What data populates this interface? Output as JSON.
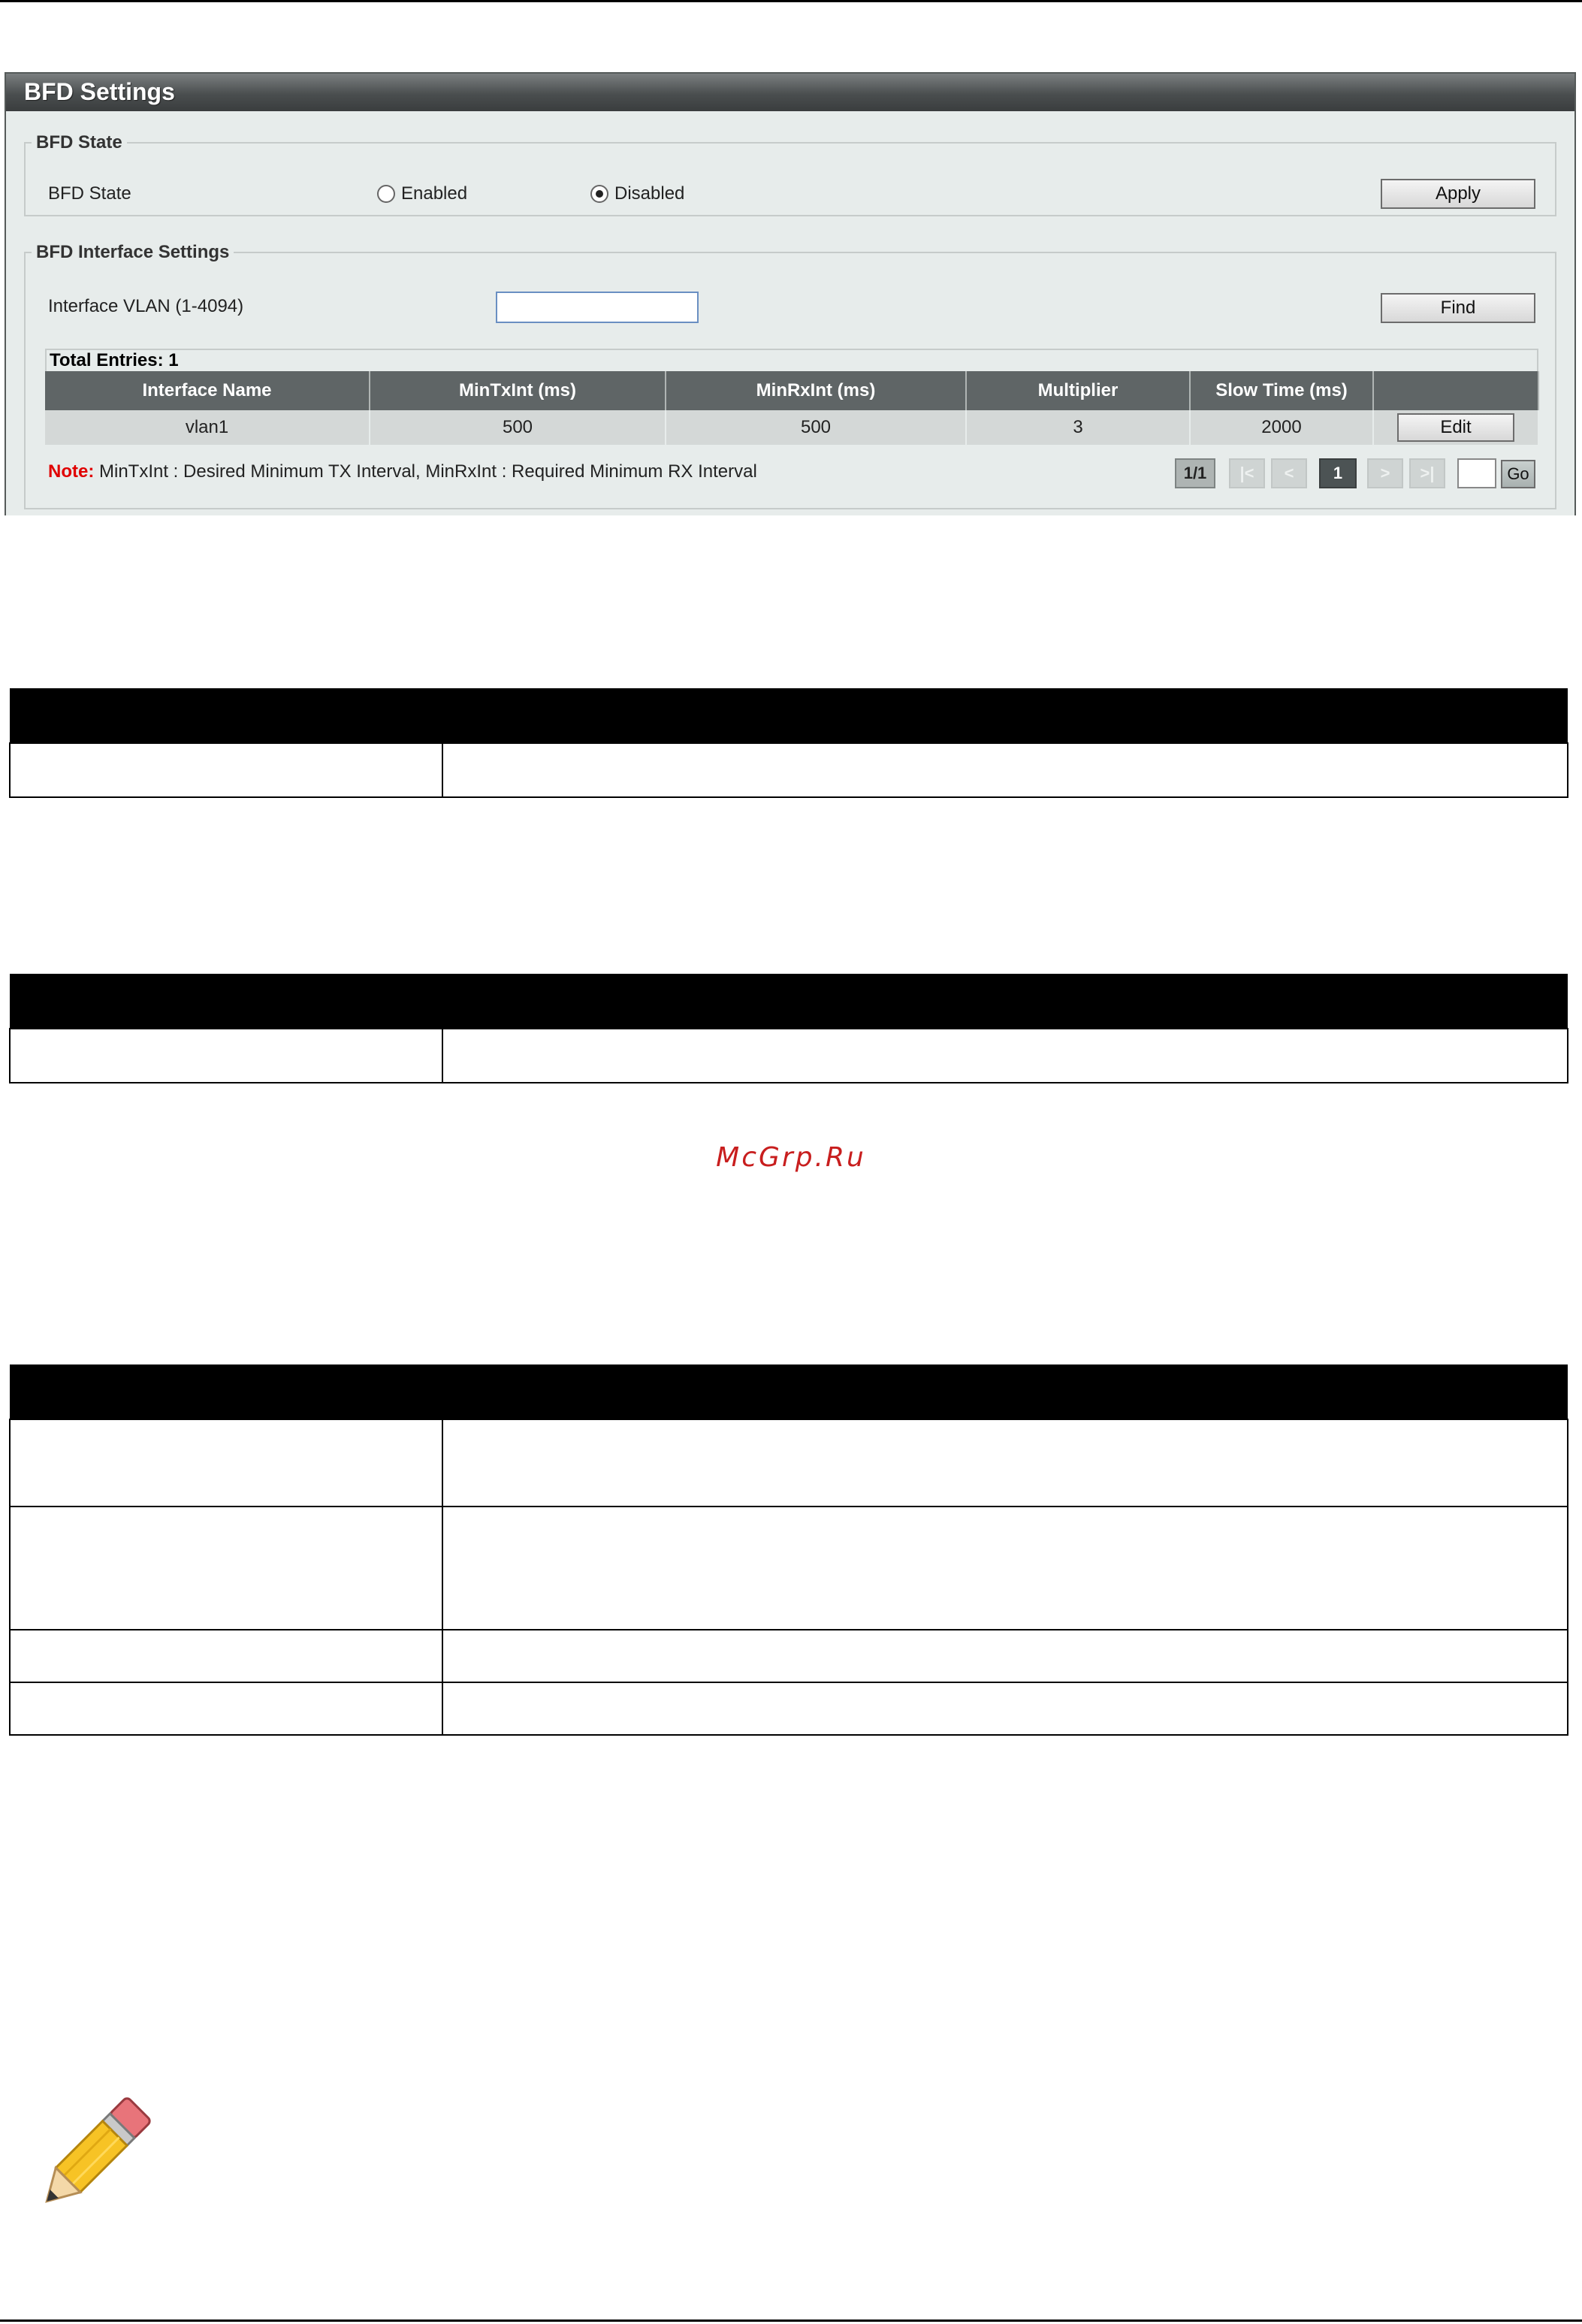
{
  "window": {
    "title": "BFD Settings"
  },
  "bfd_state_section": {
    "legend": "BFD State",
    "label": "BFD State",
    "options": [
      {
        "label": "Enabled",
        "selected": false
      },
      {
        "label": "Disabled",
        "selected": true
      }
    ],
    "apply_label": "Apply"
  },
  "interface_section": {
    "legend": "BFD Interface Settings",
    "vlan_label": "Interface VLAN (1-4094)",
    "vlan_value": "",
    "find_label": "Find",
    "total_entries": "Total Entries: 1",
    "columns": [
      "Interface Name",
      "MinTxInt (ms)",
      "MinRxInt (ms)",
      "Multiplier",
      "Slow Time (ms)",
      ""
    ],
    "rows": [
      {
        "name": "vlan1",
        "min_tx": "500",
        "min_rx": "500",
        "multiplier": "3",
        "slow_time": "2000",
        "edit_label": "Edit"
      }
    ],
    "note_label": "Note:",
    "note_text": "MinTxInt : Desired Minimum TX Interval, MinRxInt : Required Minimum RX Interval"
  },
  "pagination": {
    "page_info": "1/1",
    "first": "|<",
    "prev": "<",
    "current": "1",
    "next": ">",
    "last": ">|",
    "go_label": "Go",
    "page_input": ""
  },
  "watermark": "McGrp.Ru",
  "icons": {
    "note": "pencil-icon"
  },
  "colors": {
    "title_bar": "#4a4e4f",
    "table_header": "#5f6566",
    "note": "#e00000",
    "watermark": "#c81e1e"
  }
}
